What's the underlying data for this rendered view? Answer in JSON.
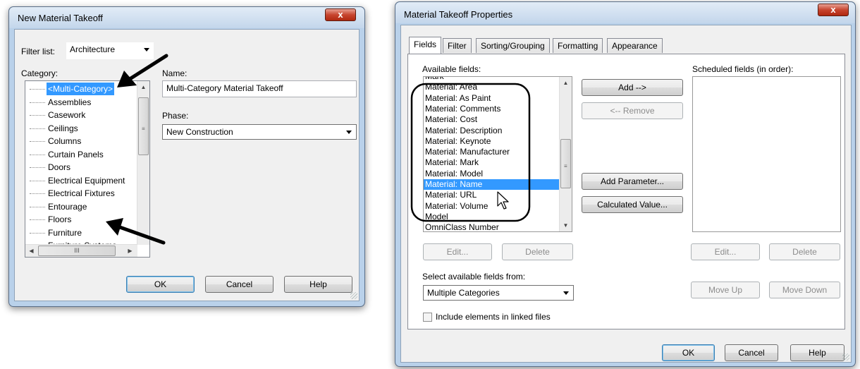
{
  "dialog1": {
    "title": "New Material Takeoff",
    "close_glyph": "x",
    "filter_label": "Filter list:",
    "filter_value": "Architecture",
    "category_label": "Category:",
    "categories": [
      "<Multi-Category>",
      "Assemblies",
      "Casework",
      "Ceilings",
      "Columns",
      "Curtain Panels",
      "Doors",
      "Electrical Equipment",
      "Electrical Fixtures",
      "Entourage",
      "Floors",
      "Furniture",
      "Furniture Systems"
    ],
    "selected_category": "<Multi-Category>",
    "hscroll_grip": "III",
    "name_label": "Name:",
    "name_value": "Multi-Category Material Takeoff",
    "phase_label": "Phase:",
    "phase_value": "New Construction",
    "ok": "OK",
    "cancel": "Cancel",
    "help": "Help"
  },
  "dialog2": {
    "title": "Material Takeoff Properties",
    "close_glyph": "x",
    "tabs": [
      {
        "label": "Fields"
      },
      {
        "label": "Filter"
      },
      {
        "label": "Sorting/Grouping"
      },
      {
        "label": "Formatting"
      },
      {
        "label": "Appearance"
      }
    ],
    "active_tab": "Fields",
    "available_label": "Available fields:",
    "available_fields": [
      "Mark",
      "Material: Area",
      "Material: As Paint",
      "Material: Comments",
      "Material: Cost",
      "Material: Description",
      "Material: Keynote",
      "Material: Manufacturer",
      "Material: Mark",
      "Material: Model",
      "Material: Name",
      "Material: URL",
      "Material: Volume",
      "Model",
      "OmniClass Number"
    ],
    "selected_field": "Material: Name",
    "scheduled_label": "Scheduled fields (in order):",
    "add": "Add -->",
    "remove": "<-- Remove",
    "add_parameter": "Add Parameter...",
    "calculated_value": "Calculated Value...",
    "edit": "Edit...",
    "delete": "Delete",
    "edit2": "Edit...",
    "delete2": "Delete",
    "select_from_label": "Select available fields from:",
    "select_from_value": "Multiple Categories",
    "move_up": "Move Up",
    "move_down": "Move Down",
    "include_linked": "Include elements in linked files",
    "ok": "OK",
    "cancel": "Cancel",
    "help": "Help"
  }
}
